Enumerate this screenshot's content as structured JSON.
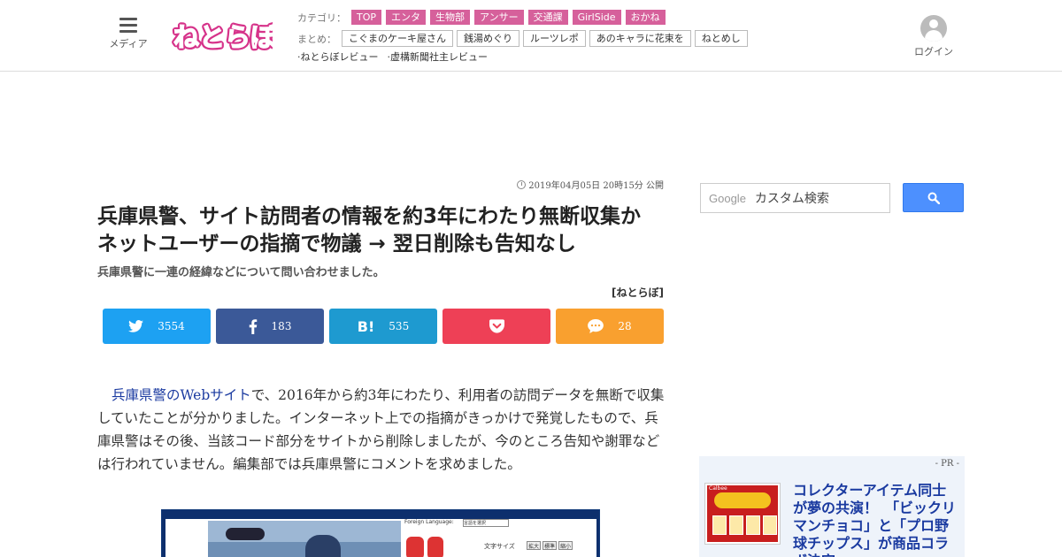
{
  "header": {
    "menu_label": "メディア",
    "logo_text": "ねとらぼ",
    "category_label": "カテゴリ：",
    "categories": [
      "TOP",
      "エンタ",
      "生物部",
      "アンサー",
      "交通課",
      "GirlSide",
      "おかね"
    ],
    "matome_label": "まとめ：",
    "matome": [
      "こぐまのケーキ屋さん",
      "銭湯めぐり",
      "ルーツレポ",
      "あのキャラに花束を",
      "ねとめし"
    ],
    "reviews": [
      "·ねとらぼレビュー",
      "·虚構新聞社主レビュー"
    ],
    "login_label": "ログイン"
  },
  "article": {
    "published": "2019年04月05日 20時15分 公開",
    "title": "兵庫県警、サイト訪問者の情報を約3年にわたり無断収集か　ネットユーザーの指摘で物議 → 翌日削除も告知なし",
    "subtitle": "兵庫県警に一連の経緯などについて問い合わせました。",
    "source": "[ねとらぼ]",
    "share": {
      "twitter": "3554",
      "facebook": "183",
      "hatena": "535",
      "comments": "28"
    },
    "body_link": "兵庫県警のWebサイト",
    "body_rest": "で、2016年から約3年にわたり、利用者の訪問データを無断で収集していたことが分かりました。インターネット上での指摘がきっかけで発覚したもので、兵庫県警はその後、当該コード部分をサイトから削除しましたが、今のところ告知や謝罪などは行われていません。編集部では兵庫県警にコメントを求めました。",
    "image": {
      "foreign_language": "Foreign Language:",
      "select_value": "言語を選択",
      "font_size_label": "文字サイズ",
      "font_buttons": [
        "拡大",
        "標準",
        "縮小"
      ]
    }
  },
  "sidebar": {
    "search_brand": "Google",
    "search_placeholder": "カスタム検索",
    "pr_label": "- PR -",
    "pr_thumb_brand": "Calbee",
    "pr_title": "コレクターアイテム同士が夢の共演！　「ビックリマンチョコ」と「プロ野球チップス」が商品コラボ決定"
  },
  "colors": {
    "category_tag": "#d6609b",
    "twitter": "#1da1f2",
    "facebook": "#3b5998",
    "hatena": "#1e9ad0",
    "pocket": "#ee4056",
    "comment": "#f9a02f",
    "search_button": "#4d90fe",
    "link": "#1a3aa0"
  }
}
